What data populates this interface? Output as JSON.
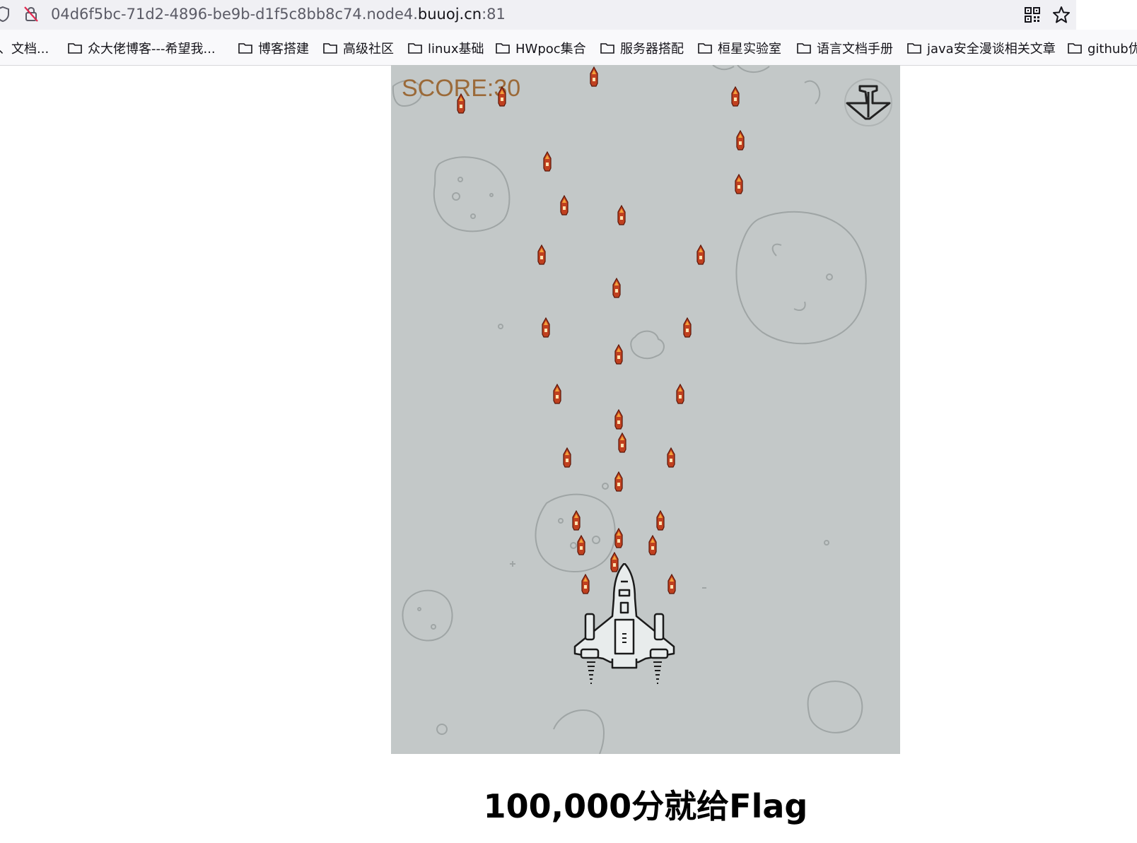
{
  "browser": {
    "url_prefix": "04d6f5bc-71d2-4896-be9b-d1f5c8bb8c74.node4.",
    "url_host": "buuoj.cn",
    "url_port": ":81"
  },
  "bookmarks": [
    {
      "label": "、文档..."
    },
    {
      "label": "众大佬博客---希望我..."
    },
    {
      "label": "博客搭建"
    },
    {
      "label": "高级社区"
    },
    {
      "label": "linux基础"
    },
    {
      "label": "HWpoc集合"
    },
    {
      "label": "服务器搭配"
    },
    {
      "label": "桓星实验室"
    },
    {
      "label": "语言文档手册"
    },
    {
      "label": "java安全漫谈相关文章"
    },
    {
      "label": "github优"
    }
  ],
  "game": {
    "score_text": "SCORE:30",
    "background_color": "#c3c8c8",
    "bullet_count": 30
  },
  "heading": "100,000分就给Flag"
}
